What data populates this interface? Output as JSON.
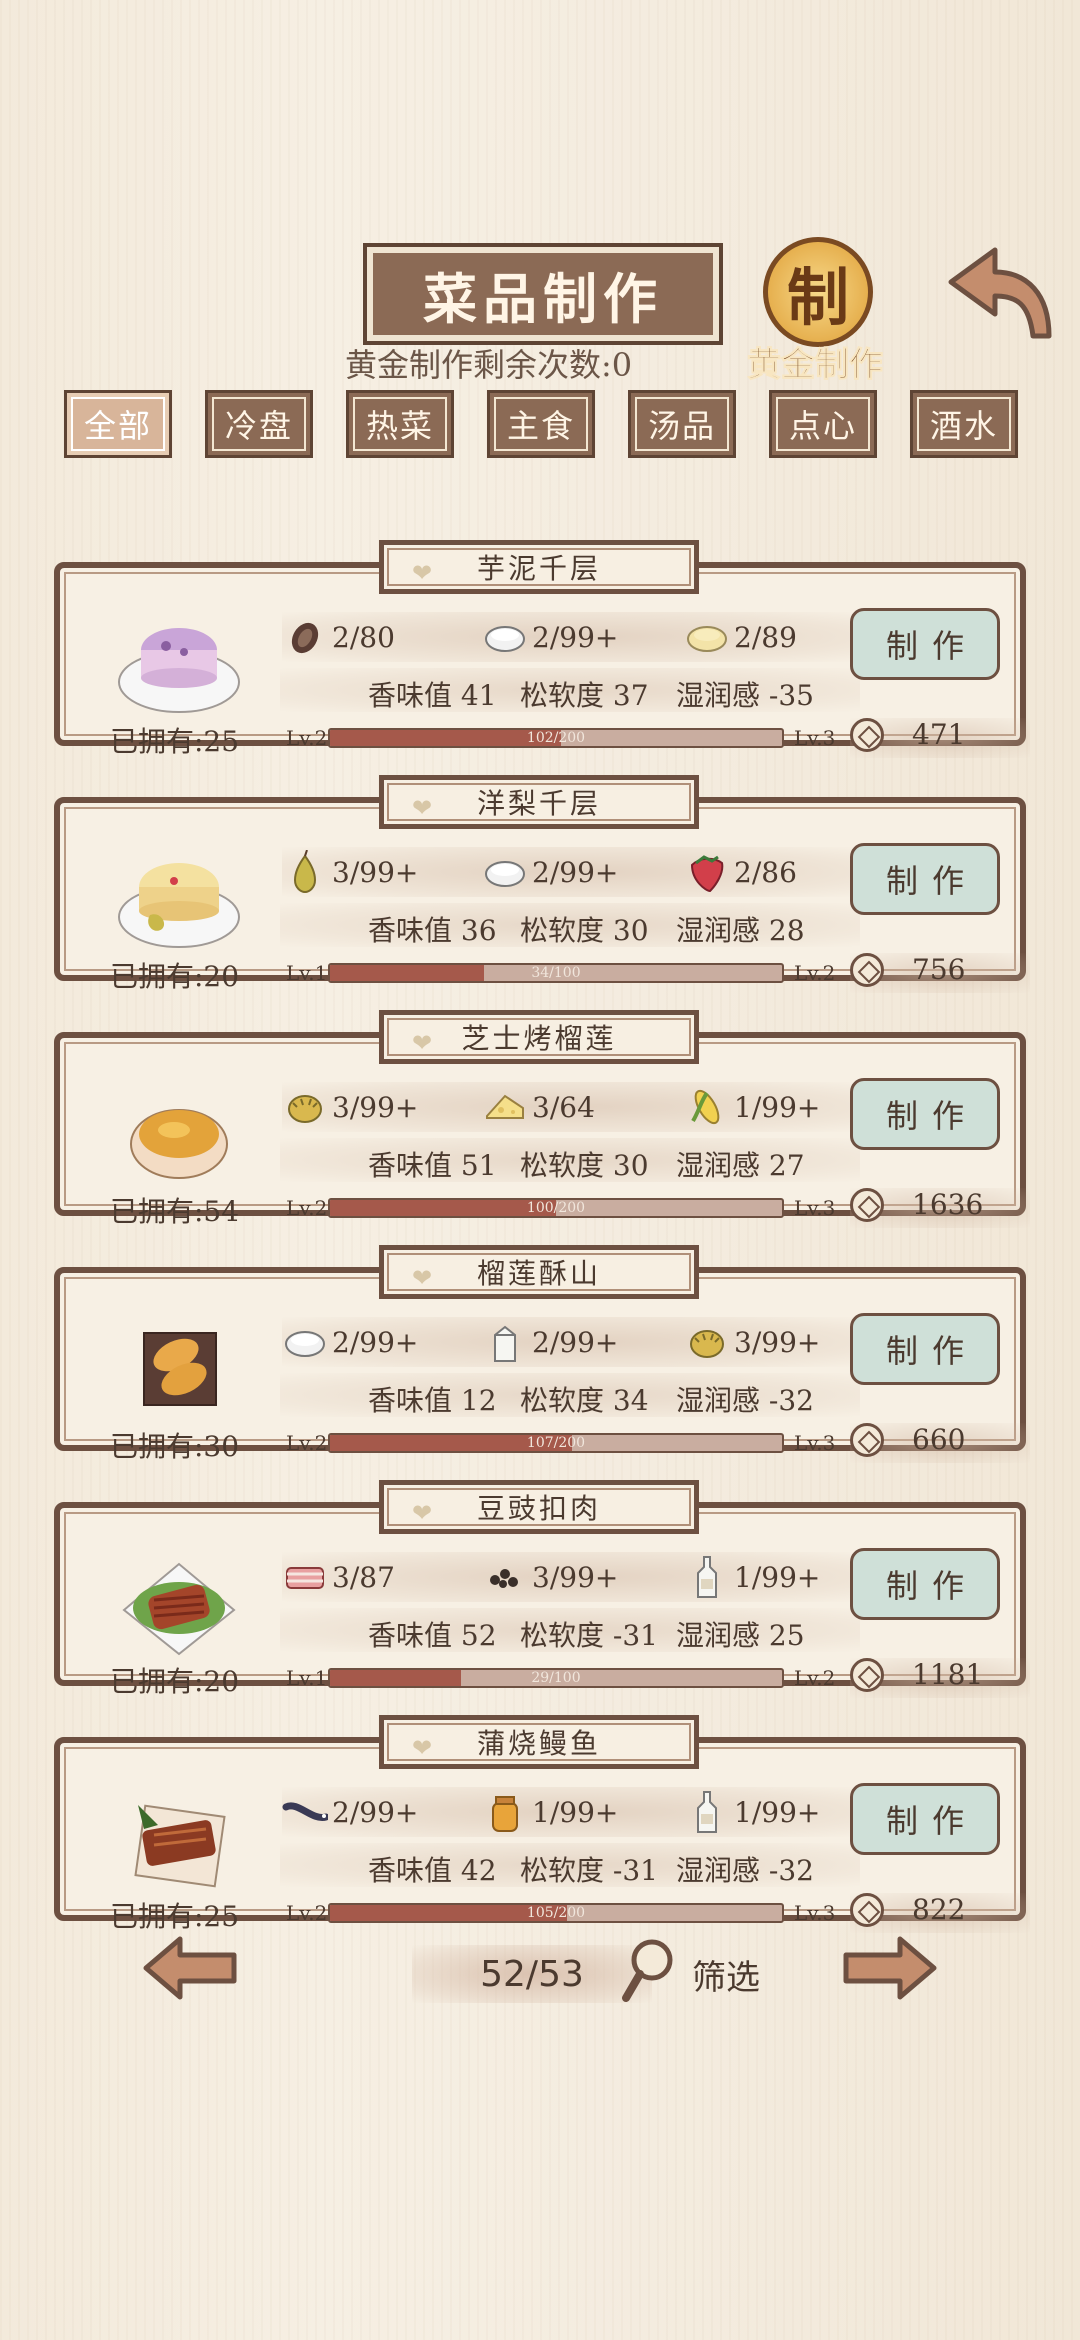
{
  "header": {
    "title": "菜品制作",
    "gold_count_label": "黄金制作剩余次数:0",
    "gold_button_glyph": "制",
    "gold_button_label": "黄金制作"
  },
  "tabs": [
    {
      "label": "全部",
      "active": true
    },
    {
      "label": "冷盘",
      "active": false
    },
    {
      "label": "热菜",
      "active": false
    },
    {
      "label": "主食",
      "active": false
    },
    {
      "label": "汤品",
      "active": false
    },
    {
      "label": "点心",
      "active": false
    },
    {
      "label": "酒水",
      "active": false
    }
  ],
  "recipes": [
    {
      "name": "芋泥千层",
      "owned": "已拥有:25",
      "dish_icon": "taro-crepe-cake-icon",
      "ingredients": [
        {
          "icon": "taro-icon",
          "count": "2/80"
        },
        {
          "icon": "flour-icon",
          "count": "2/99+"
        },
        {
          "icon": "egg-custard-icon",
          "count": "2/89"
        }
      ],
      "stats": [
        "香味值 41",
        "松软度 37",
        "湿润感 -35"
      ],
      "level_from": "Lv.2",
      "level_to": "Lv.3",
      "progress_text": "102/200",
      "progress": 0.51,
      "make_label": "制作",
      "cost": "471"
    },
    {
      "name": "洋梨千层",
      "owned": "已拥有:20",
      "dish_icon": "pear-crepe-cake-icon",
      "ingredients": [
        {
          "icon": "pear-icon",
          "count": "3/99+"
        },
        {
          "icon": "flour-icon",
          "count": "2/99+"
        },
        {
          "icon": "strawberry-icon",
          "count": "2/86"
        }
      ],
      "stats": [
        "香味值 36",
        "松软度 30",
        "湿润感 28"
      ],
      "level_from": "Lv.1",
      "level_to": "Lv.2",
      "progress_text": "34/100",
      "progress": 0.34,
      "make_label": "制作",
      "cost": "756"
    },
    {
      "name": "芝士烤榴莲",
      "owned": "已拥有:54",
      "dish_icon": "cheese-durian-bowl-icon",
      "ingredients": [
        {
          "icon": "durian-icon",
          "count": "3/99+"
        },
        {
          "icon": "cheese-icon",
          "count": "3/64"
        },
        {
          "icon": "corn-icon",
          "count": "1/99+"
        }
      ],
      "stats": [
        "香味值 51",
        "松软度 30",
        "湿润感 27"
      ],
      "level_from": "Lv.2",
      "level_to": "Lv.3",
      "progress_text": "100/200",
      "progress": 0.5,
      "make_label": "制作",
      "cost": "1636"
    },
    {
      "name": "榴莲酥山",
      "owned": "已拥有:30",
      "dish_icon": "durian-pastry-icon",
      "ingredients": [
        {
          "icon": "flour-icon",
          "count": "2/99+"
        },
        {
          "icon": "milk-carton-icon",
          "count": "2/99+"
        },
        {
          "icon": "durian-icon",
          "count": "3/99+"
        }
      ],
      "stats": [
        "香味值 12",
        "松软度 34",
        "湿润感 -32"
      ],
      "level_from": "Lv.2",
      "level_to": "Lv.3",
      "progress_text": "107/200",
      "progress": 0.535,
      "make_label": "制作",
      "cost": "660"
    },
    {
      "name": "豆豉扣肉",
      "owned": "已拥有:20",
      "dish_icon": "braised-pork-icon",
      "ingredients": [
        {
          "icon": "pork-belly-icon",
          "count": "3/87"
        },
        {
          "icon": "black-bean-icon",
          "count": "3/99+"
        },
        {
          "icon": "liquor-bottle-icon",
          "count": "1/99+"
        }
      ],
      "stats": [
        "香味值 52",
        "松软度 -31",
        "湿润感 25"
      ],
      "level_from": "Lv.1",
      "level_to": "Lv.2",
      "progress_text": "29/100",
      "progress": 0.29,
      "make_label": "制作",
      "cost": "1181"
    },
    {
      "name": "蒲烧鳗鱼",
      "owned": "已拥有:25",
      "dish_icon": "grilled-eel-icon",
      "ingredients": [
        {
          "icon": "eel-icon",
          "count": "2/99+"
        },
        {
          "icon": "honey-jar-icon",
          "count": "1/99+"
        },
        {
          "icon": "liquor-bottle-icon",
          "count": "1/99+"
        }
      ],
      "stats": [
        "香味值 42",
        "松软度 -31",
        "湿润感 -32"
      ],
      "level_from": "Lv.2",
      "level_to": "Lv.3",
      "progress_text": "105/200",
      "progress": 0.525,
      "make_label": "制作",
      "cost": "822"
    }
  ],
  "footer": {
    "page": "52/53",
    "filter_label": "筛选"
  },
  "colors": {
    "frame": "#6d5041",
    "plate": "#8b6a55",
    "button": "#cfe0d8",
    "progress_fill": "#a5594b",
    "gold": "#e6b04f"
  }
}
